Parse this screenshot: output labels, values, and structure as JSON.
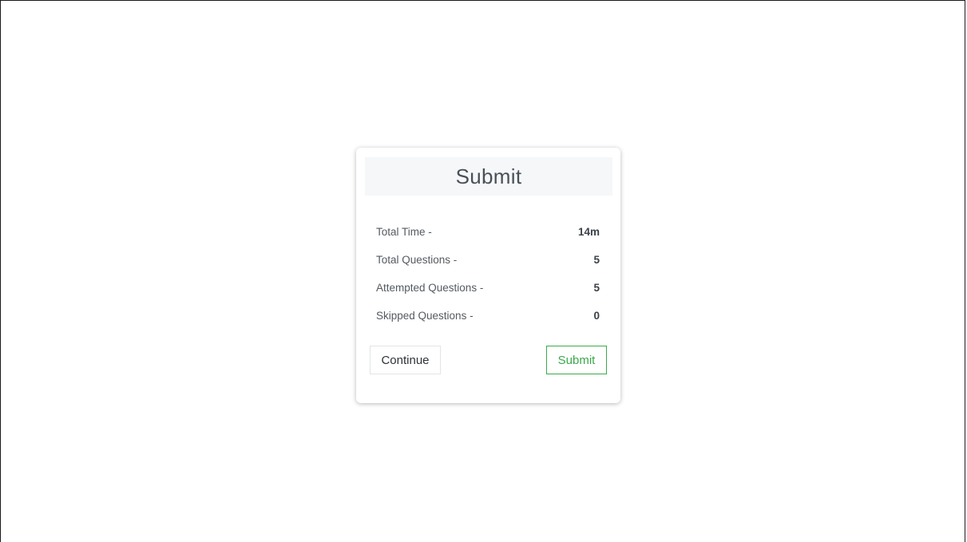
{
  "modal": {
    "title": "Submit",
    "stats": [
      {
        "label": "Total Time -",
        "value": "14m"
      },
      {
        "label": "Total Questions -",
        "value": "5"
      },
      {
        "label": "Attempted Questions -",
        "value": "5"
      },
      {
        "label": "Skipped Questions -",
        "value": "0"
      }
    ],
    "continue_label": "Continue",
    "submit_label": "Submit"
  },
  "colors": {
    "submit_accent": "#3aaa4a",
    "header_bg": "#f5f7f9"
  }
}
